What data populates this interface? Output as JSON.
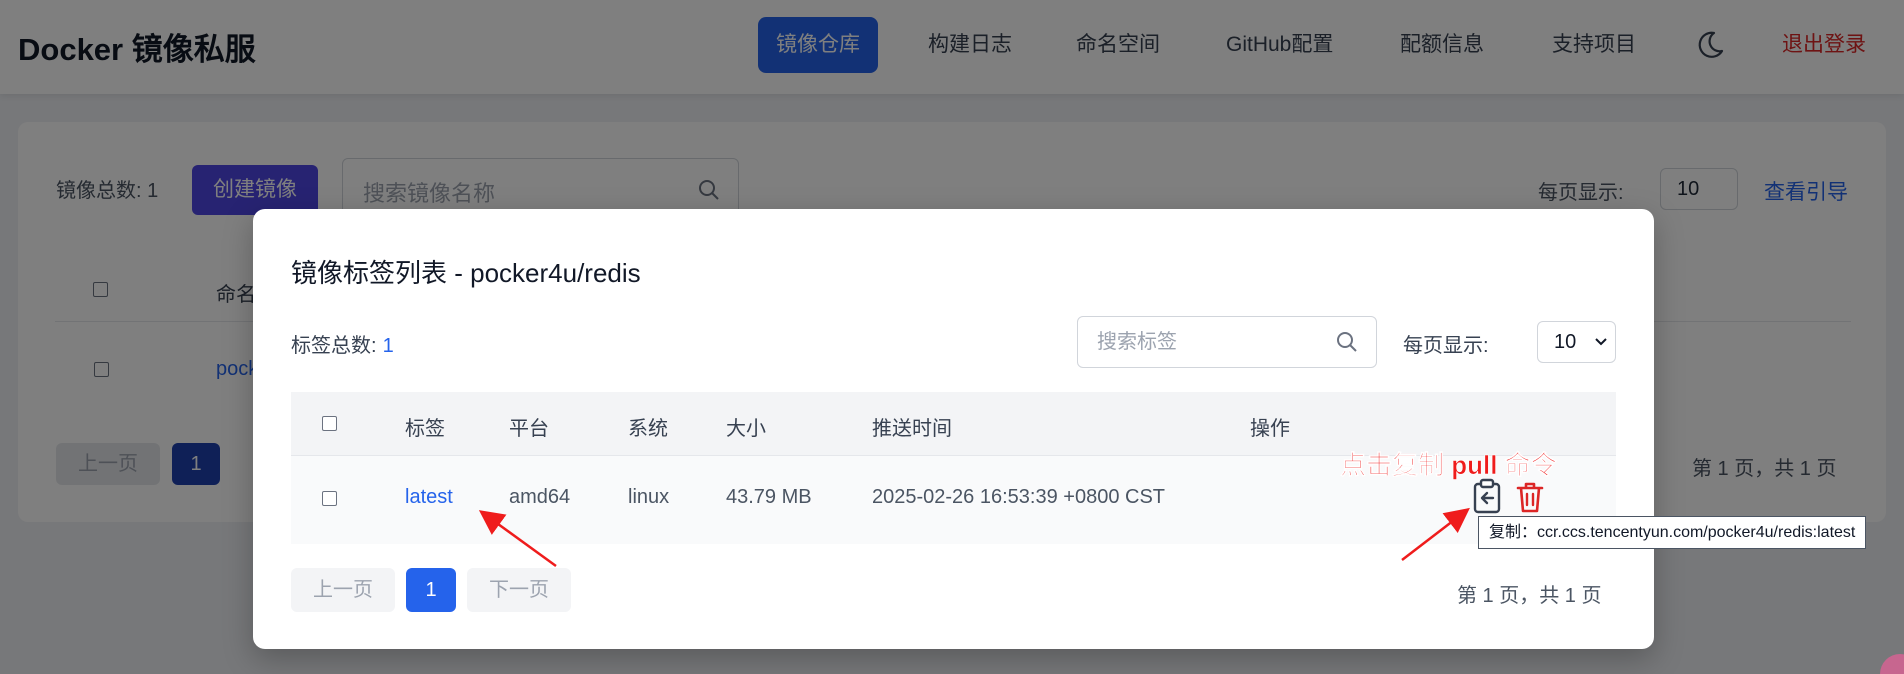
{
  "brand": "Docker 镜像私服",
  "nav": {
    "items": [
      "镜像仓库",
      "构建日志",
      "命名空间",
      "GitHub配置",
      "配额信息",
      "支持项目"
    ],
    "active": "镜像仓库",
    "logout": "退出登录",
    "theme_icon": "moon-icon"
  },
  "background": {
    "total_label": "镜像总数: 1",
    "create_button": "创建镜像",
    "search_placeholder": "搜索镜像名称",
    "per_page_label": "每页显示:",
    "per_page_value": "10",
    "guide_link": "查看引导",
    "col_name": "命名",
    "row_name": "pock",
    "prev": "上一页",
    "page": "1",
    "page_info": "第 1 页，共 1 页"
  },
  "modal": {
    "title": "镜像标签列表 - pocker4u/redis",
    "total_label": "标签总数:",
    "total_value": "1",
    "search_placeholder": "搜索标签",
    "per_page_label": "每页显示:",
    "per_page_value": "10",
    "columns": [
      "标签",
      "平台",
      "系统",
      "大小",
      "推送时间",
      "操作"
    ],
    "rows": [
      {
        "tag": "latest",
        "platform": "amd64",
        "os": "linux",
        "size": "43.79 MB",
        "pushed": "2025-02-26 16:53:39 +0800 CST"
      }
    ],
    "prev": "上一页",
    "page": "1",
    "next": "下一页",
    "page_info": "第 1 页，共 1 页"
  },
  "annotation": "点击复制 pull 命令",
  "tooltip": "复制：ccr.ccs.tencentyun.com/pocker4u/redis:latest",
  "colors": {
    "primary": "#2563eb",
    "danger": "#dc2626",
    "annotation": "#ef1c1c"
  }
}
